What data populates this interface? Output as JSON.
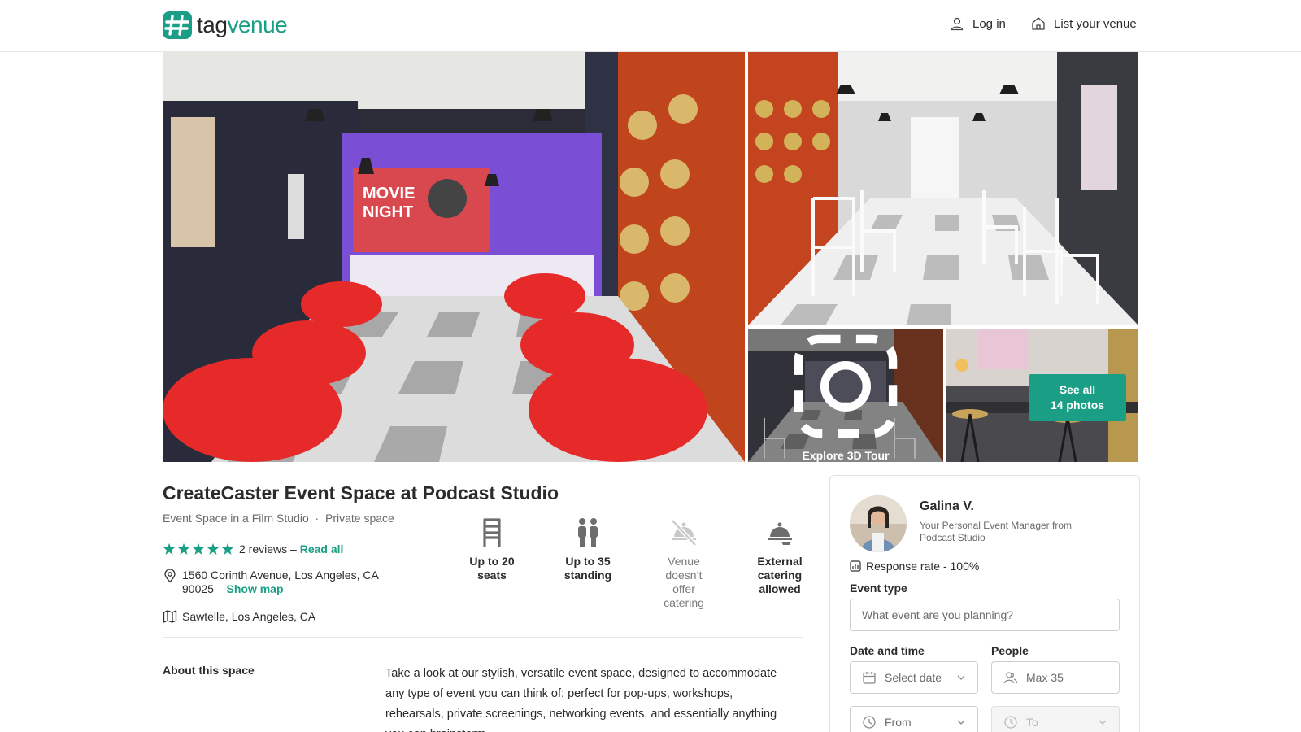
{
  "header": {
    "logo_text_a": "tag",
    "logo_text_b": "venue",
    "login_label": "Log in",
    "list_venue_label": "List your venue",
    "brand_color": "#1a9e85"
  },
  "gallery": {
    "main_poster_line1": "MOVIE",
    "main_poster_line2": "NIGHT",
    "tour_label": "Explore 3D Tour",
    "see_all_line1": "See all",
    "see_all_line2": "14 photos"
  },
  "venue": {
    "title": "CreateCaster Event Space at Podcast Studio",
    "subtitle": "Event Space in a Film Studio  ·  Private space",
    "rating_stars": 5,
    "reviews_text": "2 reviews – ",
    "read_all": "Read all",
    "address_line1": "1560 Corinth Avenue, Los Angeles, CA",
    "address_line2": "90025 – ",
    "show_map": "Show map",
    "neighborhood": "Sawtelle, Los Angeles, CA"
  },
  "features": [
    {
      "icon": "chair-icon",
      "l1": "Up to 20",
      "l2": "seats",
      "l3": "",
      "l4": ""
    },
    {
      "icon": "standing-people-icon",
      "l1": "Up to 35",
      "l2": "standing",
      "l3": "",
      "l4": ""
    },
    {
      "icon": "no-catering-icon",
      "l1": "Venue",
      "l2": "doesn’t",
      "l3": "offer",
      "l4": "catering"
    },
    {
      "icon": "catering-bell-icon",
      "l1": "External",
      "l2": "catering",
      "l3": "allowed",
      "l4": ""
    }
  ],
  "about": {
    "heading": "About this space",
    "text": "Take a look at our stylish, versatile event space, designed to accommodate any type of event you can think of: perfect for pop-ups, workshops, rehearsals, private screenings, networking events, and essentially anything you can brainstorm."
  },
  "booking": {
    "manager_name": "Galina V.",
    "manager_role": "Your Personal Event Manager from Podcast Studio",
    "response_rate": "Response rate - 100%",
    "event_type_label": "Event type",
    "event_type_placeholder": "What event are you planning?",
    "date_label": "Date and time",
    "date_placeholder": "Select date",
    "people_label": "People",
    "people_placeholder": "Max 35",
    "from_placeholder": "From",
    "to_placeholder": "To"
  }
}
